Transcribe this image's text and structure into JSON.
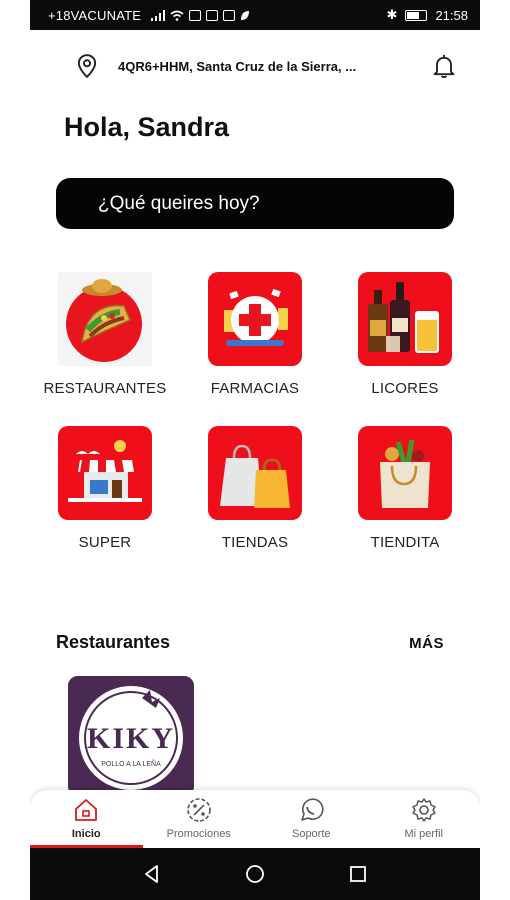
{
  "status_bar": {
    "carrier": "+18VACUNATE",
    "time": "21:58"
  },
  "header": {
    "address": "4QR6+HHM, Santa Cruz de la Sierra, ...",
    "location_icon": "map-pin-icon",
    "notification_icon": "bell-icon"
  },
  "greeting": "Hola, Sandra",
  "search": {
    "placeholder": "¿Qué queires hoy?"
  },
  "categories": [
    {
      "label": "RESTAURANTES",
      "icon": "taco-icon"
    },
    {
      "label": "FARMACIAS",
      "icon": "pharmacy-cross-icon"
    },
    {
      "label": "LICORES",
      "icon": "liquor-bottles-icon"
    },
    {
      "label": "SUPER",
      "icon": "storefront-icon"
    },
    {
      "label": "TIENDAS",
      "icon": "shopping-bags-icon"
    },
    {
      "label": "TIENDITA",
      "icon": "grocery-bag-icon"
    }
  ],
  "restaurants_section": {
    "title": "Restaurantes",
    "more_label": "MÁS",
    "items": [
      {
        "brand_text": "KIKY",
        "tagline": "POLLO A LA LEÑA"
      }
    ]
  },
  "bottom_nav": [
    {
      "label": "Inicio",
      "icon": "home-icon",
      "active": true
    },
    {
      "label": "Promociones",
      "icon": "discount-icon",
      "active": false
    },
    {
      "label": "Soporte",
      "icon": "whatsapp-icon",
      "active": false
    },
    {
      "label": "Mi perfil",
      "icon": "gear-icon",
      "active": false
    }
  ],
  "colors": {
    "accent": "#ef0f1a",
    "dark": "#050505",
    "active_underline": "#d91a1a"
  }
}
